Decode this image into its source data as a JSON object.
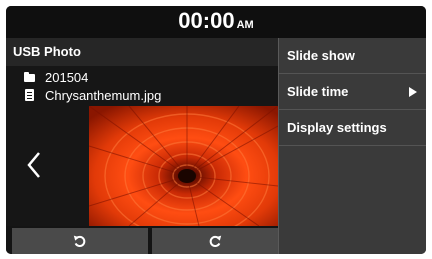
{
  "status_bar": {
    "time": "00:00",
    "ampm": "AM"
  },
  "header": {
    "title": "USB Photo"
  },
  "file_info": {
    "folder_name": "201504",
    "file_name": "Chrysanthemum.jpg"
  },
  "icons": {
    "folder": "folder-icon",
    "file": "file-icon",
    "previous": "chevron-left-icon",
    "rotate_left": "rotate-left-icon",
    "rotate_right": "rotate-right-icon",
    "submenu": "triangle-right-icon"
  },
  "menu": {
    "items": [
      {
        "label": "Slide show"
      },
      {
        "label": "Slide time"
      },
      {
        "label": "Display settings"
      }
    ]
  },
  "colors": {
    "screen_bg": "#141414",
    "menu_bg": "#3a3a3a",
    "button_bg": "#4a4a4a",
    "text": "#ffffff"
  }
}
